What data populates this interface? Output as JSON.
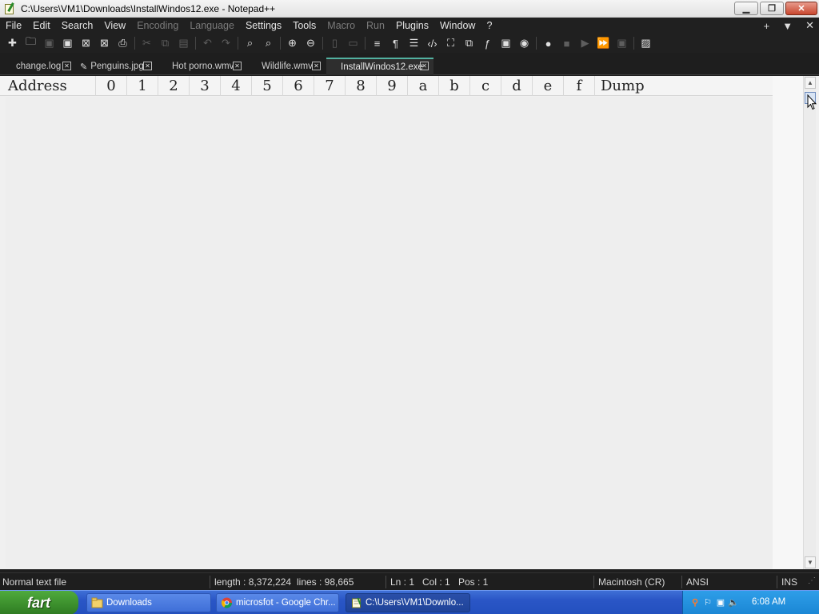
{
  "window": {
    "title": "C:\\Users\\VM1\\Downloads\\InstallWindos12.exe - Notepad++"
  },
  "menubar": {
    "items": [
      {
        "label": "File",
        "enabled": true
      },
      {
        "label": "Edit",
        "enabled": true
      },
      {
        "label": "Search",
        "enabled": true
      },
      {
        "label": "View",
        "enabled": true
      },
      {
        "label": "Encoding",
        "enabled": false
      },
      {
        "label": "Language",
        "enabled": false
      },
      {
        "label": "Settings",
        "enabled": true
      },
      {
        "label": "Tools",
        "enabled": true
      },
      {
        "label": "Macro",
        "enabled": false
      },
      {
        "label": "Run",
        "enabled": false
      },
      {
        "label": "Plugins",
        "enabled": true
      },
      {
        "label": "Window",
        "enabled": true
      },
      {
        "label": "?",
        "enabled": true
      }
    ],
    "right": {
      "add": "+",
      "dropdown": "▼",
      "close": "✕"
    }
  },
  "tabs": [
    {
      "label": "change.log",
      "active": false,
      "modified": false
    },
    {
      "label": "Penguins.jpg",
      "active": false,
      "modified": true
    },
    {
      "label": "Hot porno.wmv",
      "active": false,
      "modified": false
    },
    {
      "label": "Wildlife.wmv",
      "active": false,
      "modified": false
    },
    {
      "label": "InstallWindos12.exe",
      "active": true,
      "modified": false
    }
  ],
  "hex_view": {
    "columns": [
      "Address",
      "0",
      "1",
      "2",
      "3",
      "4",
      "5",
      "6",
      "7",
      "8",
      "9",
      "a",
      "b",
      "c",
      "d",
      "e",
      "f",
      "Dump"
    ]
  },
  "statusbar": {
    "file_type": "Normal text file",
    "length": "length : 8,372,224",
    "lines": "lines : 98,665",
    "ln": "Ln : 1",
    "col": "Col : 1",
    "pos": "Pos : 1",
    "eol": "Macintosh (CR)",
    "encoding": "ANSI",
    "mode": "INS"
  },
  "taskbar": {
    "start_label": "fart",
    "tasks": [
      {
        "label": "Downloads",
        "active": false,
        "icon": "folder-icon"
      },
      {
        "label": "microsfot - Google Chr...",
        "active": false,
        "icon": "chrome-icon"
      },
      {
        "label": "C:\\Users\\VM1\\Downlo...",
        "active": true,
        "icon": "notepadpp-icon"
      }
    ],
    "clock": "6:08 AM"
  },
  "colors": {
    "menubar_bg": "#202020",
    "editor_bg": "#f0f0f0",
    "active_tab_accent": "#52b1a0",
    "taskbar_blue": "#2a56c6",
    "start_green": "#3b8e2c",
    "tray_blue": "#1a86d4"
  }
}
